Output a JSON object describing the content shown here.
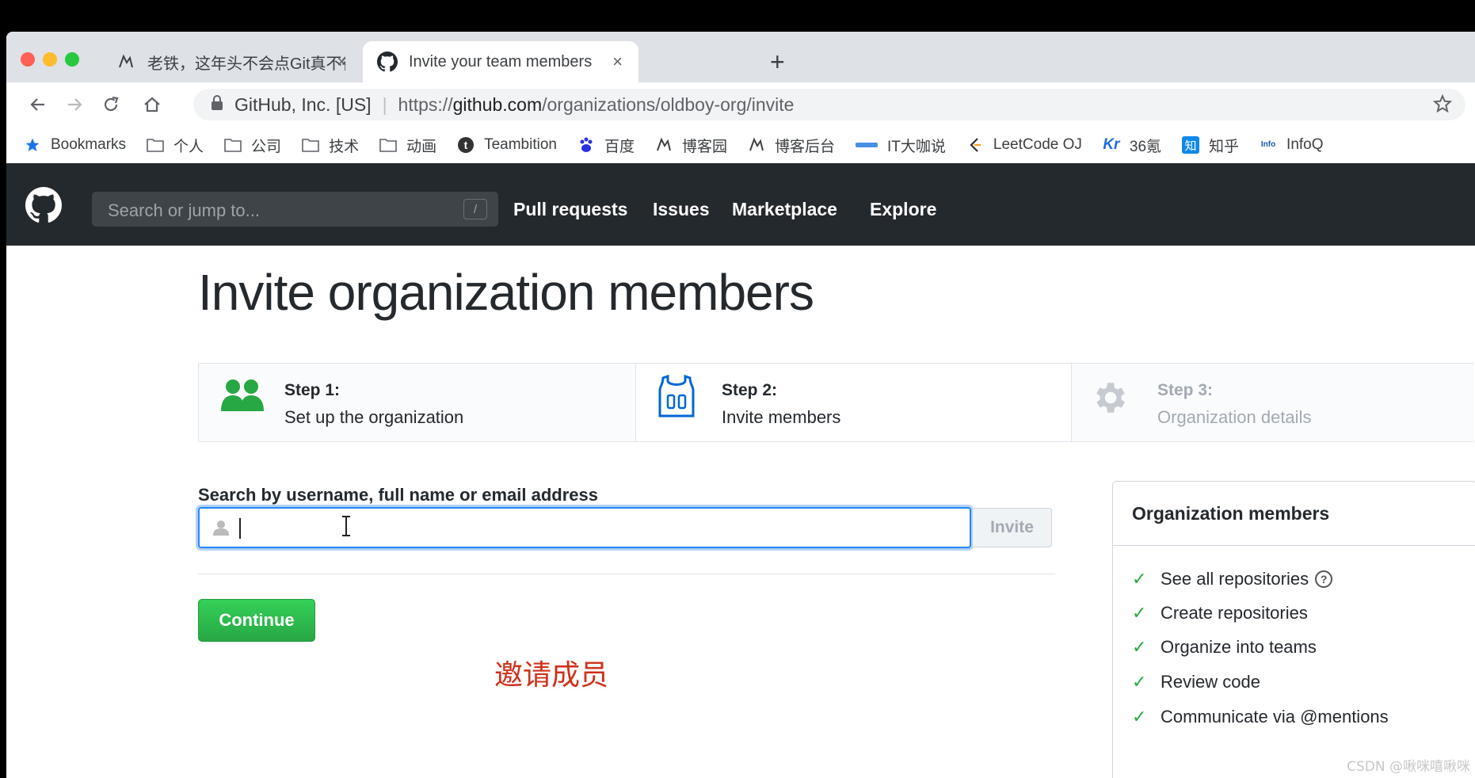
{
  "browser": {
    "tabs": [
      {
        "title": "老铁，这年头不会点Git真不行!",
        "favicon": "cnblogs-icon",
        "close": "×"
      },
      {
        "title": "Invite your team members",
        "favicon": "github-icon",
        "close": "×"
      }
    ],
    "new_tab": "+",
    "address": {
      "org": "GitHub, Inc. [US]",
      "separator": "|",
      "protocol": "https://",
      "host": "github.com",
      "path": "/organizations/oldboy-org/invite"
    },
    "bookmarks": [
      {
        "label": "Bookmarks",
        "icon": "star-icon"
      },
      {
        "label": "个人",
        "icon": "folder-icon"
      },
      {
        "label": "公司",
        "icon": "folder-icon"
      },
      {
        "label": "技术",
        "icon": "folder-icon"
      },
      {
        "label": "动画",
        "icon": "folder-icon"
      },
      {
        "label": "Teambition",
        "icon": "teambition-icon"
      },
      {
        "label": "百度",
        "icon": "baidu-icon"
      },
      {
        "label": "博客园",
        "icon": "cnblogs-icon"
      },
      {
        "label": "博客后台",
        "icon": "cnblogs-icon"
      },
      {
        "label": "IT大咖说",
        "icon": "itdks-icon"
      },
      {
        "label": "LeetCode OJ",
        "icon": "leetcode-icon"
      },
      {
        "label": "36氪",
        "icon": "36kr-icon"
      },
      {
        "label": "知乎",
        "icon": "zhihu-icon"
      },
      {
        "label": "InfoQ",
        "icon": "infoq-icon"
      }
    ]
  },
  "github": {
    "search_placeholder": "Search or jump to...",
    "search_shortcut": "/",
    "nav": [
      "Pull requests",
      "Issues",
      "Marketplace",
      "Explore"
    ]
  },
  "page": {
    "title": "Invite organization members",
    "steps": [
      {
        "title": "Step 1:",
        "desc": "Set up the organization",
        "state": "done"
      },
      {
        "title": "Step 2:",
        "desc": "Invite members",
        "state": "current"
      },
      {
        "title": "Step 3:",
        "desc": "Organization details",
        "state": "disabled"
      }
    ],
    "search_label": "Search by username, full name or email address",
    "search_value": "",
    "invite_button": "Invite",
    "continue_button": "Continue",
    "overlay_caption": "邀请成员"
  },
  "members_panel": {
    "title": "Organization members",
    "permissions": [
      "See all repositories",
      "Create repositories",
      "Organize into teams",
      "Review code",
      "Communicate via @mentions"
    ]
  },
  "watermark": "CSDN @啾咪嘻啾咪",
  "colors": {
    "accent": "#2188ff",
    "success": "#28a745",
    "header": "#24292e",
    "caption": "#d0301a"
  }
}
